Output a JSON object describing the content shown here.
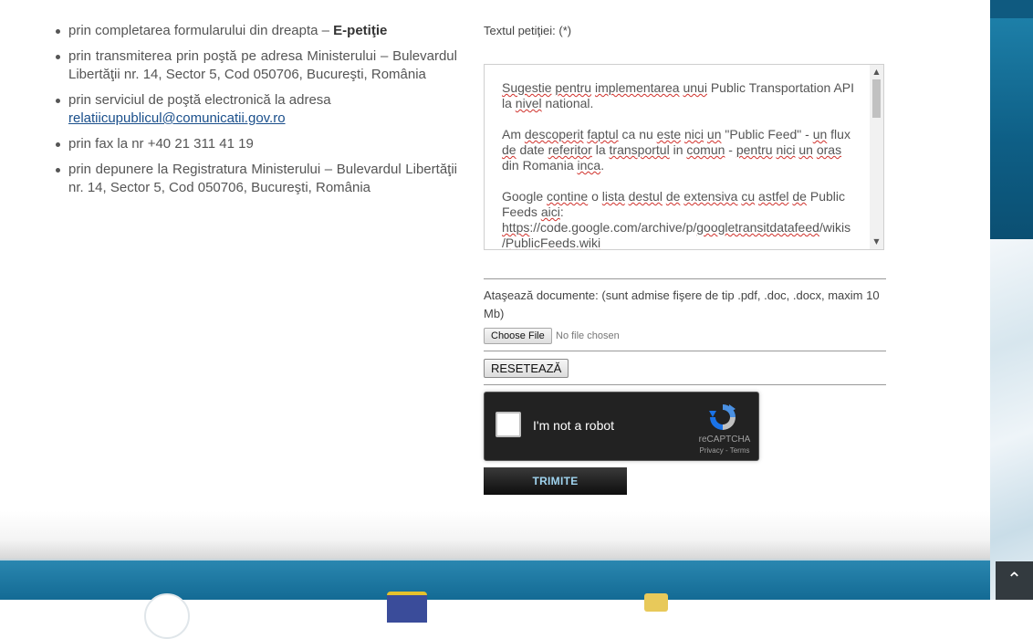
{
  "contact_list": [
    {
      "text": "prin completarea formularului din dreapta – ",
      "bold": "E-petiţie"
    },
    {
      "text": "prin transmiterea prin poştă pe adresa Ministerului – Bulevardul Libertăţii nr. 14, Sector 5, Cod 050706, Bucureşti, România"
    },
    {
      "text": "prin serviciul de poştă electronică la adresa",
      "link": "relatiicupublicul@comunicatii.gov.ro"
    },
    {
      "text": "prin fax la nr +40 21 311 41 19"
    },
    {
      "text": "prin depunere la Registratura Ministerului – Bulevardul Libertăţii nr. 14, Sector 5, Cod 050706, Bucureşti, România"
    }
  ],
  "form": {
    "petition_label": "Textul petiţiei: (*)",
    "petition_text": {
      "p1": [
        "Sugestie",
        "pentru",
        "implementarea",
        "unui",
        "Public Transportation API la",
        "nivel",
        "national."
      ],
      "p2": [
        "Am",
        "descoperit",
        "faptul",
        "ca nu",
        "este",
        "nici",
        "un",
        "\"Public Feed\" -",
        "un",
        "flux",
        "de",
        "date",
        "referitor",
        "la",
        "transportul",
        "in",
        "comun",
        "-",
        "pentru",
        "nici",
        "un",
        "oras",
        "din Romania",
        "inca",
        "."
      ],
      "p3_a": "Google",
      "p3_b": "contine",
      "p3_c": "o",
      "p3_d": "lista",
      "p3_e": "destul",
      "p3_f": "de",
      "p3_g": "extensiva",
      "p3_h": "cu",
      "p3_i": "astfel",
      "p3_j": "de",
      "p3_k": "Public Feeds",
      "p3_l": "aici",
      "p3_m": ":",
      "url_a": "https",
      "url_b": "://code.google.com/archive/p/",
      "url_c": "googletransitdatafeed",
      "url_d": "/wikis /",
      "url_e": "PublicFeeds.wiki"
    },
    "attach_label": "Ataşează documente: (sunt admise fişere de tip .pdf, .doc, .docx, maxim 10 Mb)",
    "choose_file_label": "Choose File",
    "file_status": "No file chosen",
    "reset_label": "RESETEAZĂ",
    "recaptcha": {
      "label": "I'm not a robot",
      "brand": "reCAPTCHA",
      "links": "Privacy - Terms"
    },
    "submit_label": "TRIMITE"
  },
  "scroll_top_icon": "chevron-up-icon",
  "colors": {
    "link": "#1a4f8b",
    "footer": "#136a94",
    "submit_text": "#9fd3ee"
  }
}
